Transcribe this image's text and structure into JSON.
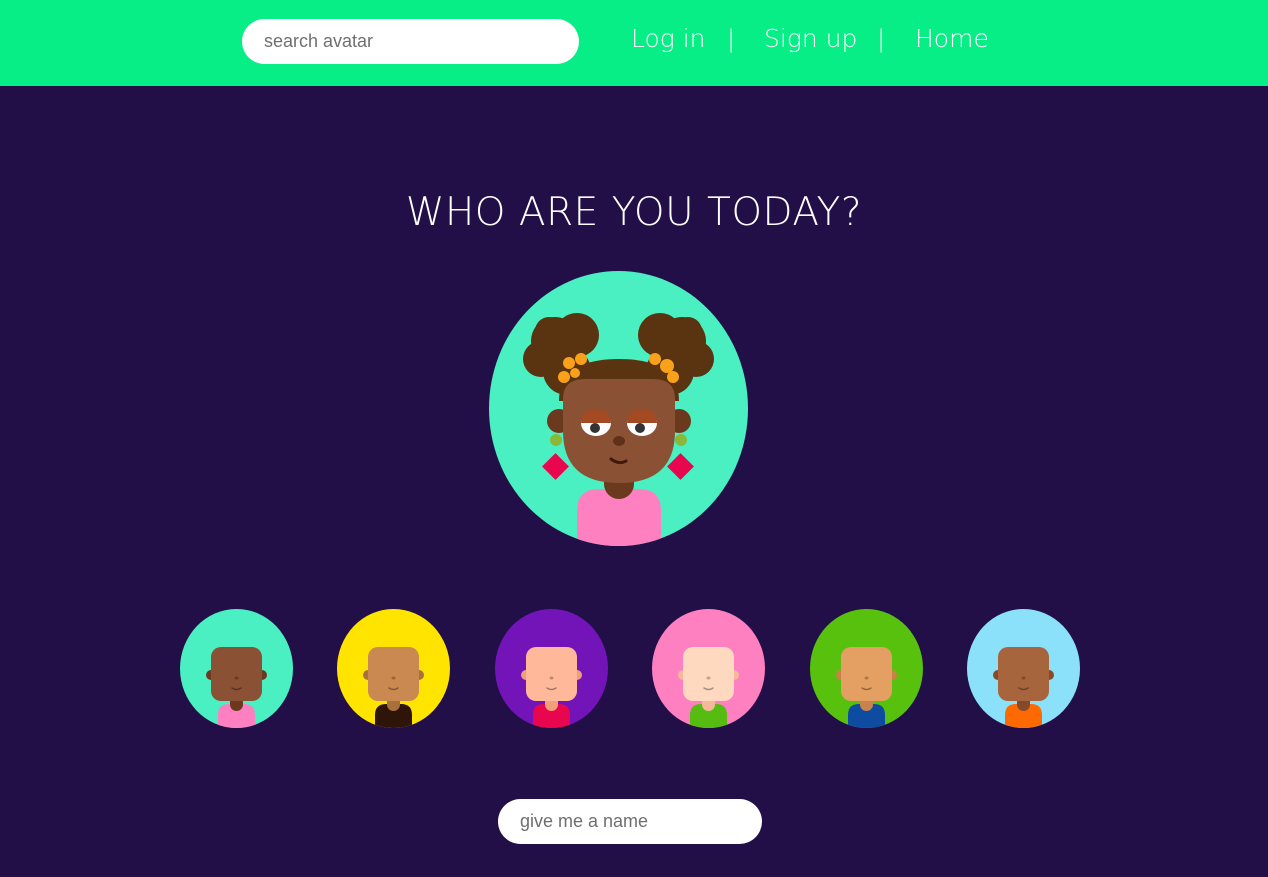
{
  "header": {
    "search": {
      "placeholder": "search avatar"
    },
    "nav": [
      {
        "label": "Log in"
      },
      {
        "label": "|"
      },
      {
        "label": "Sign up"
      },
      {
        "label": "|"
      },
      {
        "label": "Home"
      }
    ]
  },
  "main": {
    "title": "WHO ARE YOU TODAY?",
    "selected_avatar": {
      "bg": "#4aefc2",
      "skin": "#8b5135",
      "hair": "#5a3310",
      "shirt": "#ff80c0",
      "accent": "#f9a11b",
      "earring": "#e8064e"
    },
    "avatars": [
      {
        "bg": "#4aefc2",
        "skin": "#8b5135",
        "shirt": "#ff80c0",
        "neck": "#6b3a1e"
      },
      {
        "bg": "#ffe400",
        "skin": "#c98950",
        "shirt": "#2f1509",
        "neck": "#a8703d"
      },
      {
        "bg": "#7214b7",
        "skin": "#ffb99a",
        "shirt": "#e8064e",
        "neck": "#f19e7a"
      },
      {
        "bg": "#ff80c0",
        "skin": "#ffd8c0",
        "shirt": "#56bc11",
        "neck": "#f4b89a"
      },
      {
        "bg": "#57c10d",
        "skin": "#e3a062",
        "shirt": "#0d4ca1",
        "neck": "#c9834a"
      },
      {
        "bg": "#8be1f9",
        "skin": "#a7653e",
        "shirt": "#ff6a00",
        "neck": "#86492a"
      }
    ],
    "name_input": {
      "placeholder": "give me a name"
    }
  },
  "colors": {
    "header_bg": "#06ee85",
    "page_bg": "#220f47"
  }
}
